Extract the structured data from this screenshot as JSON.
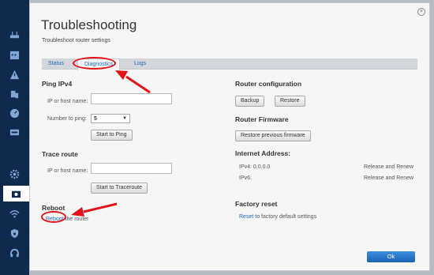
{
  "panel": {
    "title": "Troubleshooting",
    "subtitle": "Troubleshoot router settings",
    "close_icon": "×"
  },
  "tabs": [
    {
      "label": "Status"
    },
    {
      "label": "Diagnostics"
    },
    {
      "label": "Logs"
    }
  ],
  "ping": {
    "heading": "Ping IPv4",
    "host_label": "IP or host name:",
    "host_value": "",
    "count_label": "Number to ping:",
    "count_value": "5",
    "start_label": "Start to Ping"
  },
  "trace": {
    "heading": "Trace route",
    "host_label": "IP or host name:",
    "host_value": "",
    "start_label": "Start to Traceroute"
  },
  "reboot": {
    "heading": "Reboot",
    "link": "Reboot",
    "suffix": "the router"
  },
  "router_config": {
    "heading": "Router configuration",
    "backup": "Backup",
    "restore": "Restore"
  },
  "firmware": {
    "heading": "Router Firmware",
    "restore_prev": "Restore previous firmware"
  },
  "internet": {
    "heading": "Internet Address:",
    "ipv4_label": "IPv4: 0.0.0.0",
    "ipv6_label": "IPv6:",
    "release_renew": "Release and Renew"
  },
  "factory": {
    "heading": "Factory reset",
    "link": "Reset",
    "suffix": "to factory default settings"
  },
  "footer": {
    "ok": "Ok"
  },
  "sidebar_icons": [
    "wifi-router-icon",
    "calendar-icon",
    "warning-icon",
    "devices-icon",
    "speedometer-icon",
    "network-icon",
    "gear-icon",
    "troubleshooting-icon",
    "wireless-icon",
    "security-icon",
    "headset-icon"
  ],
  "colors": {
    "accent": "#1c6ab8",
    "annotation": "#e2121a",
    "sidebar": "#0f2a4d"
  }
}
